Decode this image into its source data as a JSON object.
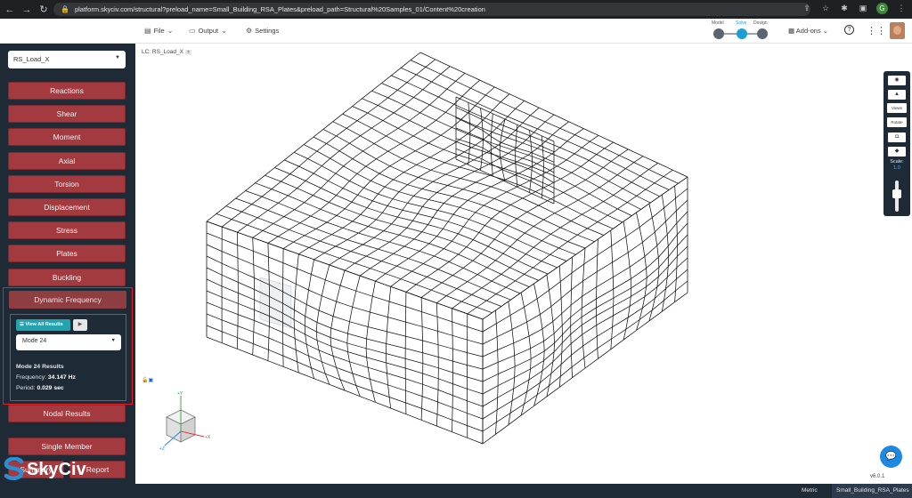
{
  "browser": {
    "url": "platform.skyciv.com/structural?preload_name=Small_Building_RSA_Plates&preload_path=Structural%20Samples_01/Content%20creation",
    "profile_initial": "G"
  },
  "header": {
    "menus": [
      {
        "label": "File",
        "icon": "file-icon"
      },
      {
        "label": "Output",
        "icon": "monitor-icon"
      },
      {
        "label": "Settings",
        "icon": "gear-icon"
      }
    ],
    "workflow": {
      "model": "Model",
      "solve": "Solve",
      "design": "Design"
    },
    "addons": "Add-ons"
  },
  "sidebar": {
    "load_case": "RS_Load_X",
    "result_buttons": [
      "Reactions",
      "Shear",
      "Moment",
      "Axial",
      "Torsion",
      "Displacement",
      "Stress",
      "Plates",
      "Buckling"
    ],
    "dynamic": {
      "button": "Dynamic Frequency",
      "view_all": "View All Results",
      "mode": "Mode 24",
      "results_title": "Mode 24 Results",
      "frequency_label": "Frequency:",
      "frequency_value": "34.147 Hz",
      "period_label": "Period:",
      "period_value": "0.029 sec"
    },
    "nodal": "Nodal Results",
    "single_member": "Single Member",
    "summary": "Summary",
    "report": "Report",
    "logo": "SkyCiv"
  },
  "canvas": {
    "lc_label": "LC: RS_Load_X",
    "toolbox": {
      "views": "Views",
      "rotate": "Rotate",
      "scale_label": "Scale:",
      "scale_value": "1.0"
    },
    "axes": {
      "x": "+X",
      "y": "+Y",
      "z": "+Z"
    },
    "version": "v6.0.1"
  },
  "footer": {
    "units": "Metric",
    "project": "Small_Building_RSA_Plates"
  },
  "colors": {
    "sidebar": "#1f2a37",
    "button": "#a23a3f",
    "highlight": "#e02226",
    "accent": "#23a3b0"
  }
}
